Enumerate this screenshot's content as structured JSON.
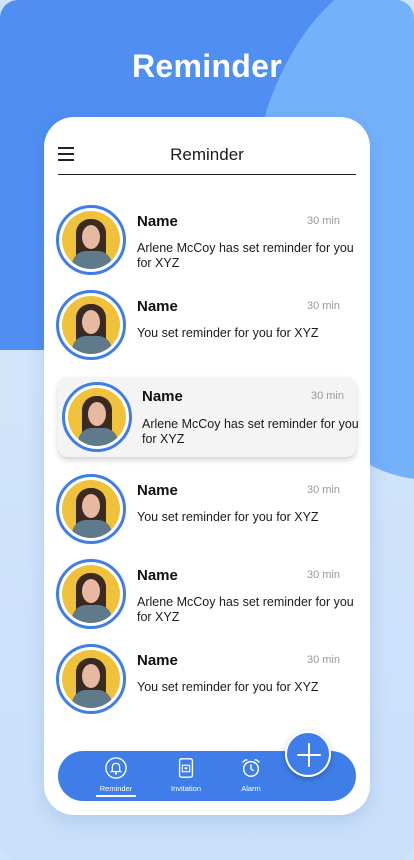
{
  "screen_title": "Reminder",
  "header": {
    "title": "Reminder"
  },
  "items": [
    {
      "name": "Name",
      "time": "30 min",
      "message": "Arlene McCoy has set reminder for you for XYZ"
    },
    {
      "name": "Name",
      "time": "30 min",
      "message": "You set reminder for you for XYZ"
    },
    {
      "name": "Name",
      "time": "30 min",
      "message": "Arlene McCoy has set reminder for you for XYZ"
    },
    {
      "name": "Name",
      "time": "30 min",
      "message": "You set reminder for you for XYZ"
    },
    {
      "name": "Name",
      "time": "30 min",
      "message": "Arlene McCoy has set reminder for you for XYZ"
    },
    {
      "name": "Name",
      "time": "30 min",
      "message": "You set reminder for you for XYZ"
    }
  ],
  "nav": [
    {
      "label": "Reminder",
      "icon": "bell-icon",
      "active": true
    },
    {
      "label": "Invitation",
      "icon": "invitation-icon",
      "active": false
    },
    {
      "label": "Alarm",
      "icon": "alarm-clock-icon",
      "active": false
    }
  ],
  "fab": {
    "icon": "plus-icon"
  },
  "colors": {
    "primary": "#3f7ee8",
    "light_blue": "#74b1fb",
    "background": "#cfe3fb"
  }
}
